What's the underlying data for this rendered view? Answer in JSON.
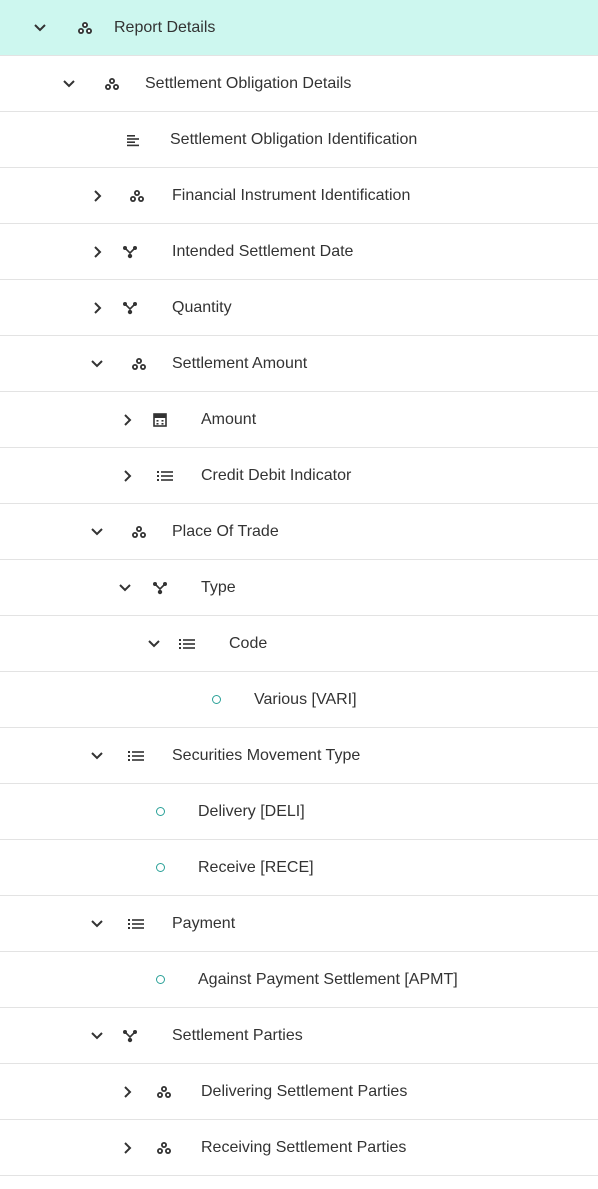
{
  "accent_color": "#cdf7ef",
  "tree": {
    "items": [
      {
        "label": "Report Details",
        "state": "expanded",
        "icon": "group-icon",
        "selected": true
      },
      {
        "label": "Settlement Obligation Details",
        "state": "expanded",
        "icon": "group-icon"
      },
      {
        "label": "Settlement Obligation Identification",
        "state": "none",
        "icon": "text-field-icon"
      },
      {
        "label": "Financial Instrument Identification",
        "state": "collapsed",
        "icon": "group-icon"
      },
      {
        "label": "Intended Settlement Date",
        "state": "collapsed",
        "icon": "choice-icon"
      },
      {
        "label": "Quantity",
        "state": "collapsed",
        "icon": "choice-icon"
      },
      {
        "label": "Settlement Amount",
        "state": "expanded",
        "icon": "group-icon"
      },
      {
        "label": "Amount",
        "state": "collapsed",
        "icon": "calculator-icon"
      },
      {
        "label": "Credit Debit Indicator",
        "state": "collapsed",
        "icon": "list-icon"
      },
      {
        "label": "Place Of Trade",
        "state": "expanded",
        "icon": "group-icon"
      },
      {
        "label": "Type",
        "state": "expanded",
        "icon": "choice-icon"
      },
      {
        "label": "Code",
        "state": "expanded",
        "icon": "list-icon"
      },
      {
        "label": "Various [VARI]",
        "state": "none",
        "icon": "value-icon"
      },
      {
        "label": "Securities Movement Type",
        "state": "expanded",
        "icon": "list-icon"
      },
      {
        "label": "Delivery [DELI]",
        "state": "none",
        "icon": "value-icon"
      },
      {
        "label": "Receive [RECE]",
        "state": "none",
        "icon": "value-icon"
      },
      {
        "label": "Payment",
        "state": "expanded",
        "icon": "list-icon"
      },
      {
        "label": "Against Payment Settlement [APMT]",
        "state": "none",
        "icon": "value-icon"
      },
      {
        "label": "Settlement Parties",
        "state": "expanded",
        "icon": "choice-icon"
      },
      {
        "label": "Delivering Settlement Parties",
        "state": "collapsed",
        "icon": "group-icon"
      },
      {
        "label": "Receiving Settlement Parties",
        "state": "collapsed",
        "icon": "group-icon"
      }
    ]
  }
}
